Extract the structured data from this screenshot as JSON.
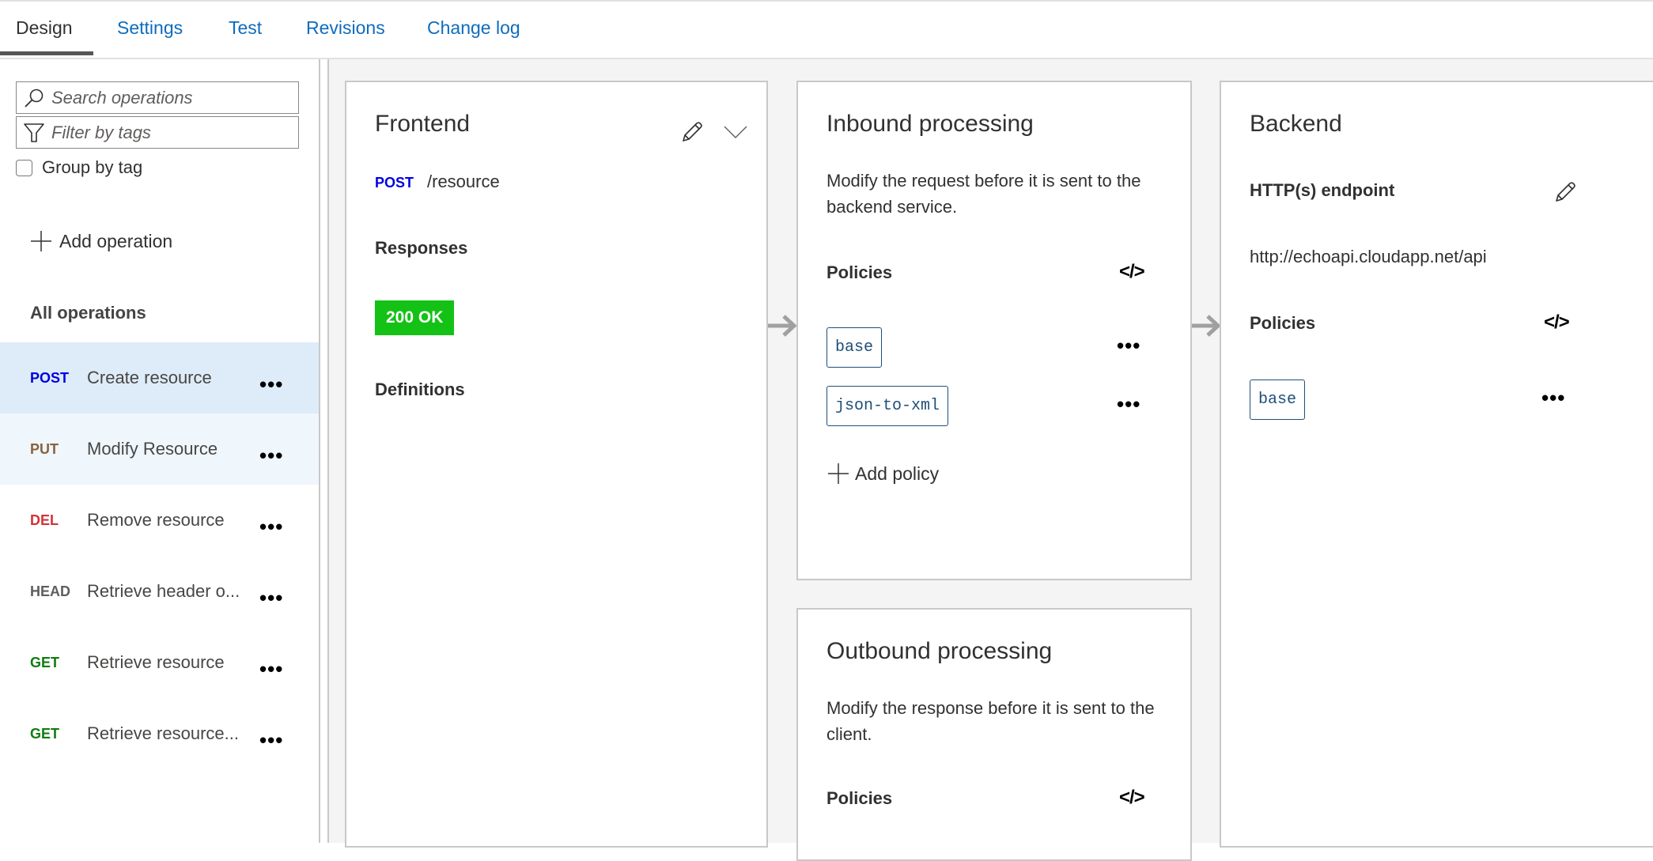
{
  "tabs": [
    {
      "label": "Design",
      "active": true
    },
    {
      "label": "Settings"
    },
    {
      "label": "Test"
    },
    {
      "label": "Revisions"
    },
    {
      "label": "Change log"
    }
  ],
  "sidebar": {
    "search_placeholder": "Search operations",
    "filter_placeholder": "Filter by tags",
    "group_by_tag_label": "Group by tag",
    "group_by_tag_checked": false,
    "add_operation_label": "Add operation",
    "all_operations_label": "All operations",
    "operations": [
      {
        "method": "POST",
        "name": "Create resource",
        "color": "#0000e0",
        "state": "selected"
      },
      {
        "method": "PUT",
        "name": "Modify Resource",
        "color": "#8a6240",
        "state": "hover"
      },
      {
        "method": "DEL",
        "name": "Remove resource",
        "color": "#d13438"
      },
      {
        "method": "HEAD",
        "name": "Retrieve header o...",
        "color": "#605e5c"
      },
      {
        "method": "GET",
        "name": "Retrieve resource",
        "color": "#107c10"
      },
      {
        "method": "GET",
        "name": "Retrieve resource...",
        "color": "#107c10"
      }
    ],
    "more_label": "•••"
  },
  "frontend": {
    "title": "Frontend",
    "method": "POST",
    "path": "/resource",
    "responses_label": "Responses",
    "response_badge": "200 OK",
    "definitions_label": "Definitions"
  },
  "inbound": {
    "title": "Inbound processing",
    "description": "Modify the request before it is sent to the backend service.",
    "policies_label": "Policies",
    "code_icon": "</>",
    "policies": [
      "base",
      "json-to-xml"
    ],
    "add_policy_label": "Add policy"
  },
  "outbound": {
    "title": "Outbound processing",
    "description": "Modify the response before it is sent to the client.",
    "policies_label": "Policies",
    "code_icon": "</>"
  },
  "backend": {
    "title": "Backend",
    "endpoint_label": "HTTP(s) endpoint",
    "endpoint_url": "http://echoapi.cloudapp.net/api",
    "policies_label": "Policies",
    "code_icon": "</>",
    "policies": [
      "base"
    ]
  },
  "colors": {
    "accent": "#0f6cbd",
    "selected_row": "#deecf9",
    "hover_row": "#eff6fc",
    "ok_badge": "#13c215",
    "chip_border": "#1f4e79"
  }
}
